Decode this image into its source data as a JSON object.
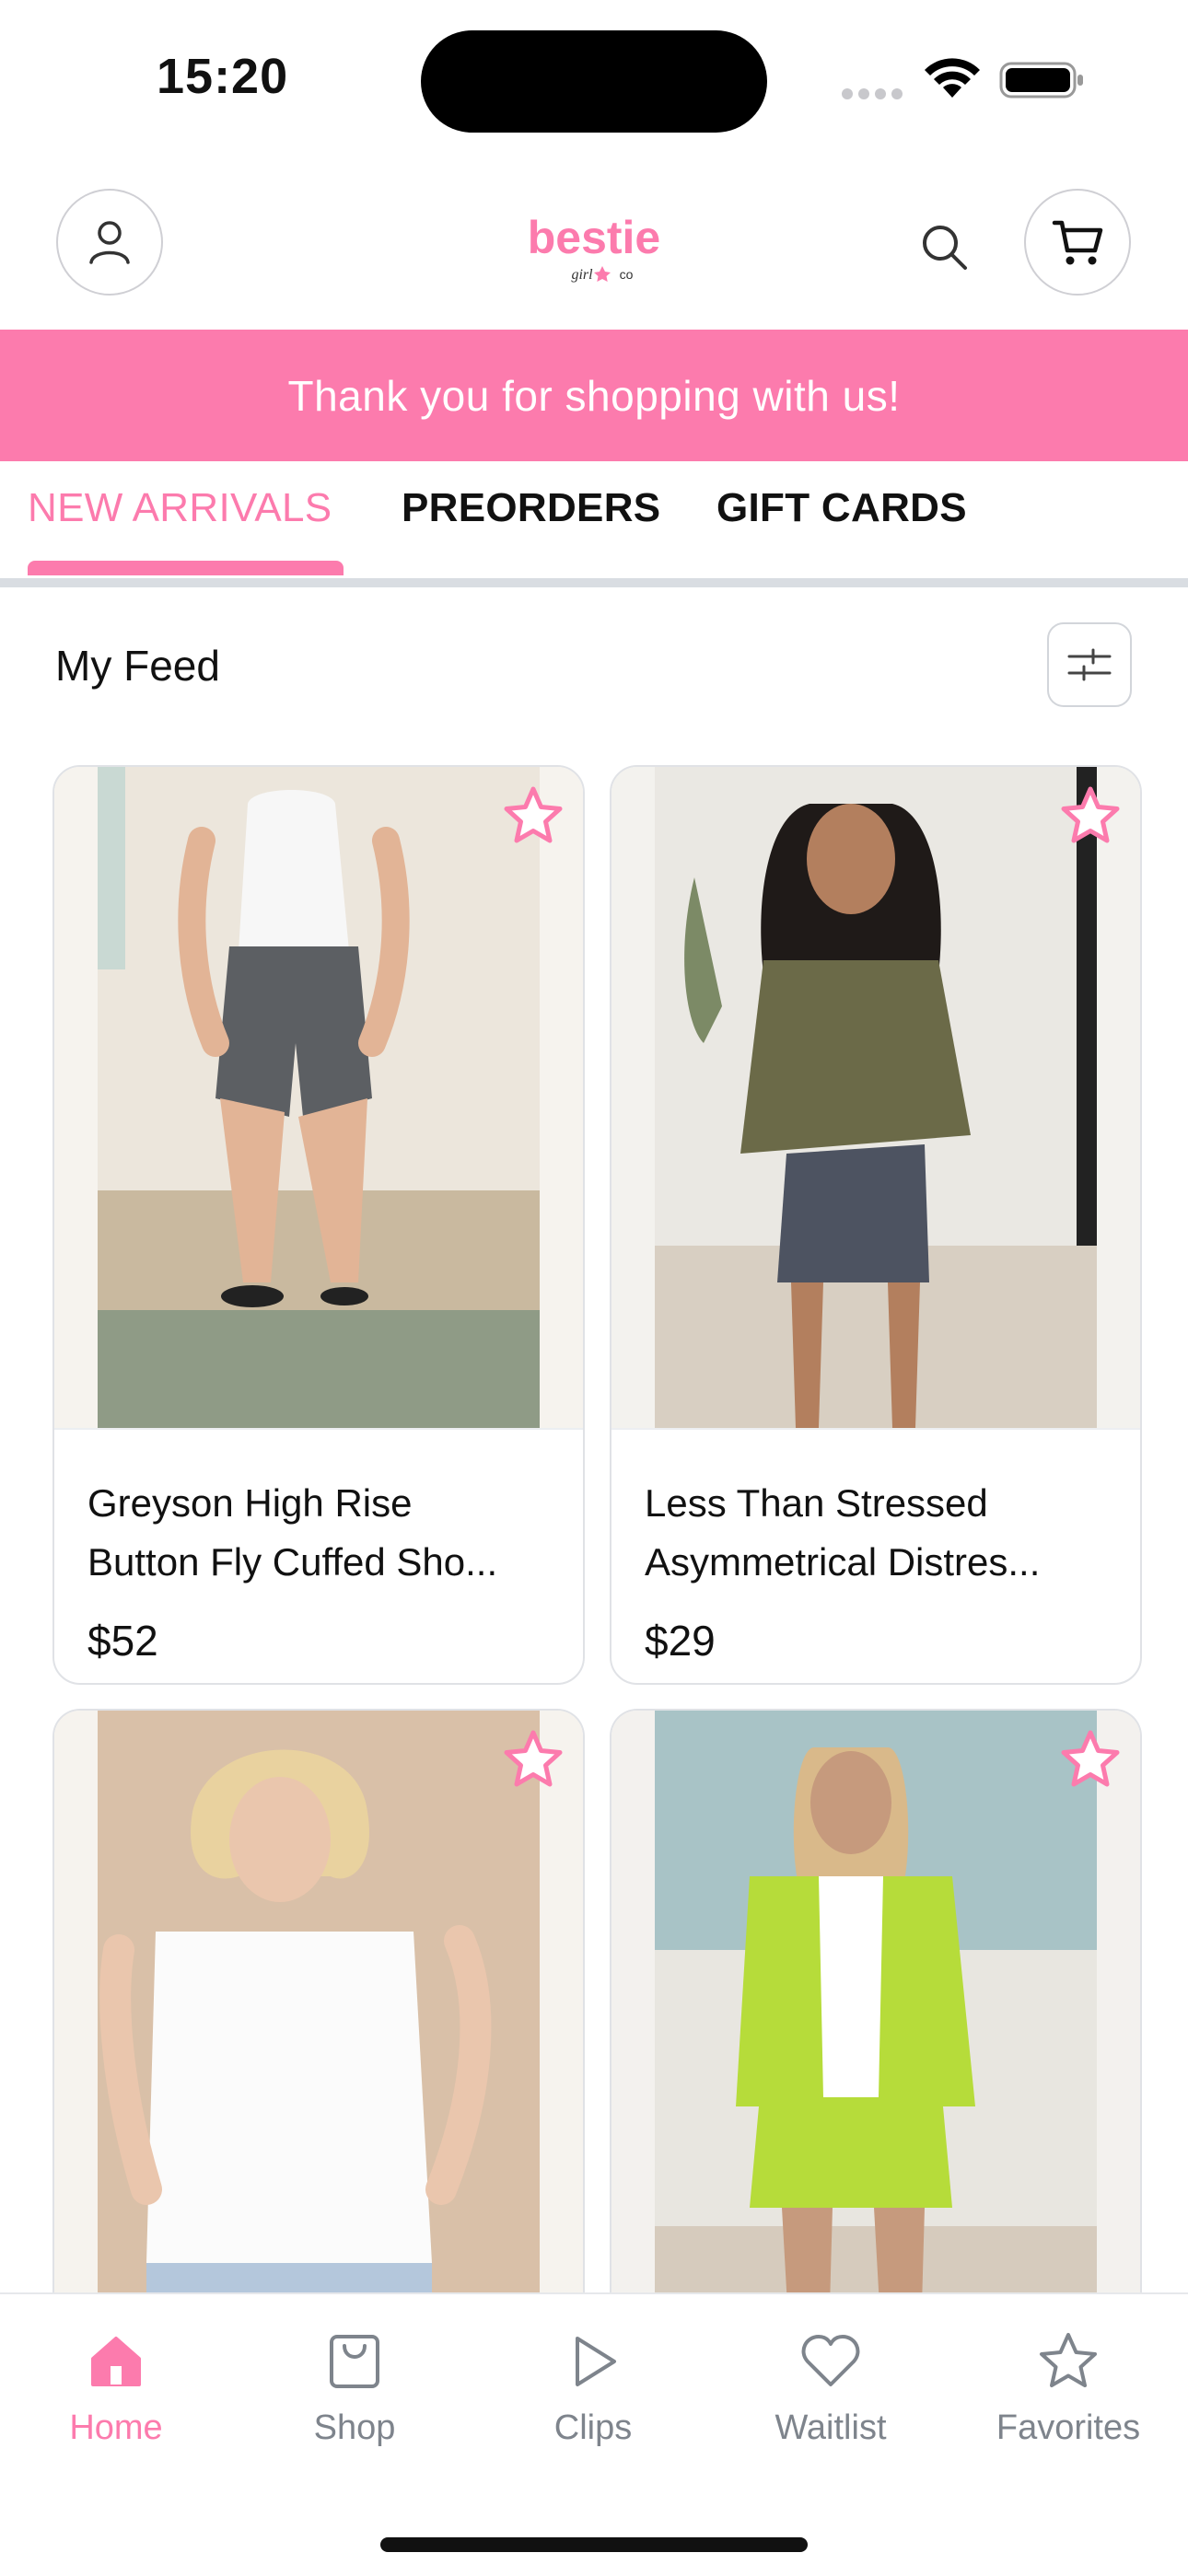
{
  "status_bar": {
    "time": "15:20"
  },
  "header": {
    "logo_text": "bestie",
    "logo_subtext": "girl co",
    "brand_color": "#fc7bad"
  },
  "banner": {
    "text": "Thank you for shopping with us!"
  },
  "tabs": [
    {
      "label": "NEW ARRIVALS",
      "active": true
    },
    {
      "label": "PREORDERS",
      "active": false
    },
    {
      "label": "GIFT CARDS",
      "active": false
    }
  ],
  "feed": {
    "title": "My Feed"
  },
  "products": [
    {
      "name_line1": "Greyson High Rise",
      "name_line2": "Button Fly Cuffed Sho...",
      "price": "$52",
      "icon": "star-outline-icon"
    },
    {
      "name_line1": "Less Than Stressed",
      "name_line2": "Asymmetrical Distres...",
      "price": "$29",
      "icon": "star-outline-icon"
    },
    {
      "name_line1": "",
      "name_line2": "",
      "price": "",
      "icon": "star-outline-icon"
    },
    {
      "name_line1": "",
      "name_line2": "",
      "price": "",
      "icon": "star-outline-icon"
    }
  ],
  "bottom_nav": [
    {
      "label": "Home",
      "icon": "home-icon",
      "active": true
    },
    {
      "label": "Shop",
      "icon": "shopping-bag-icon",
      "active": false
    },
    {
      "label": "Clips",
      "icon": "play-icon",
      "active": false
    },
    {
      "label": "Waitlist",
      "icon": "heart-icon",
      "active": false
    },
    {
      "label": "Favorites",
      "icon": "star-icon",
      "active": false
    }
  ]
}
